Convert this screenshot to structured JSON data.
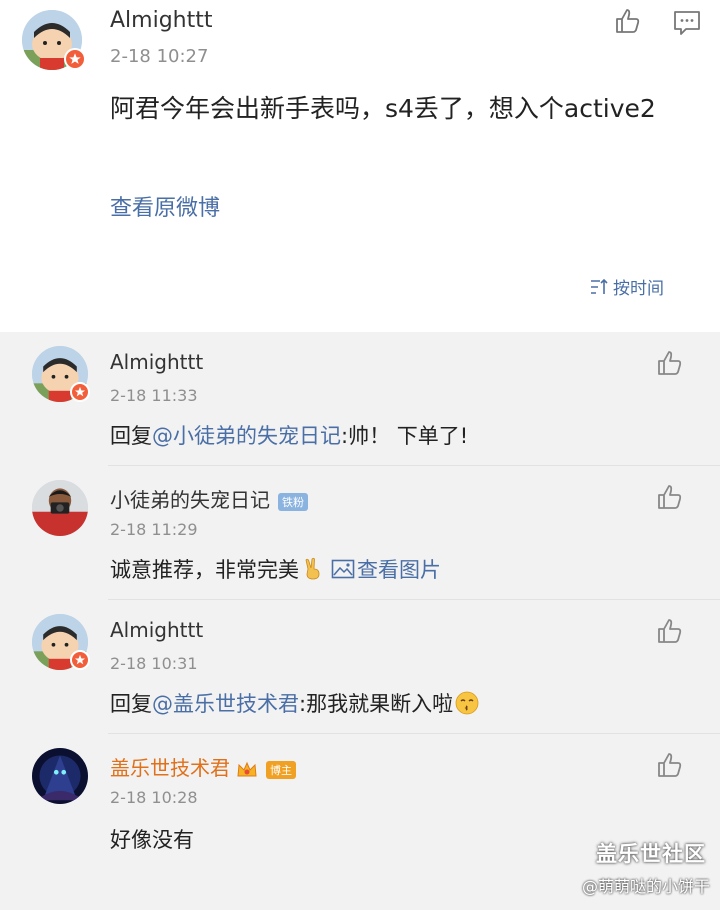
{
  "main_post": {
    "username": "Almighttt",
    "time": "2-18 10:27",
    "text": "阿君今年会出新手表吗，s4丢了，想入个active2",
    "view_original": "查看原微博",
    "sort_label": "按时间"
  },
  "comments": [
    {
      "username": "Almighttt",
      "time": "2-18 11:33",
      "reply_prefix": "回复",
      "mention": "@小徒弟的失宠日记",
      "text": ":帅！ 下单了!"
    },
    {
      "username": "小徒弟的失宠日记",
      "tag": "铁粉",
      "time": "2-18 11:29",
      "text": "诚意推荐，非常完美",
      "emoji": "victory-hand",
      "link": "查看图片"
    },
    {
      "username": "Almighttt",
      "time": "2-18 10:31",
      "reply_prefix": "回复",
      "mention": "@盖乐世技术君",
      "text": ":那我就果断入啦",
      "emoji": "kissing-face"
    },
    {
      "username": "盖乐世技术君",
      "tag": "博主",
      "time": "2-18 10:28",
      "text": "好像没有"
    }
  ],
  "watermark": {
    "title": "盖乐世社区",
    "subtitle": "@萌萌哒的小饼干"
  },
  "colors": {
    "link": "#4a6fa6",
    "author": "#e0701a",
    "badge": "#f25d3a"
  }
}
